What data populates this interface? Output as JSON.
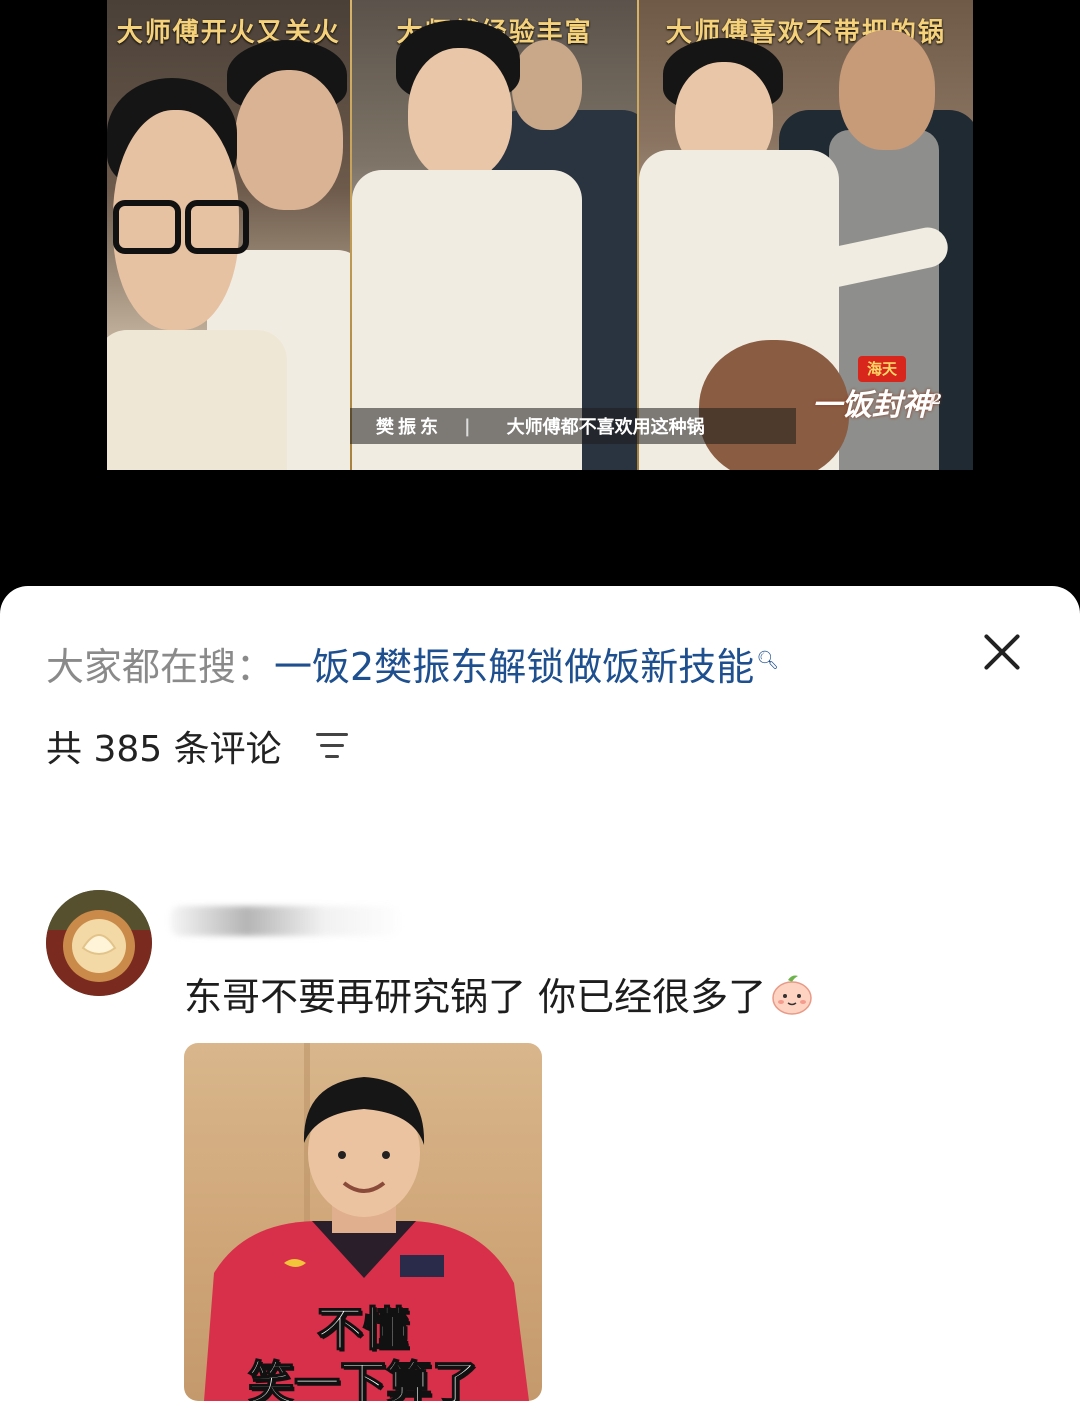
{
  "video": {
    "panels": [
      {
        "caption": "大师傅开火又关火"
      },
      {
        "caption": "大师傅经验丰富"
      },
      {
        "caption": "大师傅喜欢不带把的锅"
      }
    ],
    "subtitle": {
      "speaker": "樊振东",
      "separator": "|",
      "text": "大师傅都不喜欢用这种锅"
    },
    "logo": {
      "sponsor": "海天",
      "title": "一饭封神",
      "superscript": "2"
    }
  },
  "comments_sheet": {
    "search": {
      "prefix": "大家都在搜：",
      "query": "一饭2樊振东解锁做饭新技能",
      "icon": "search-icon"
    },
    "close_icon": "close-icon",
    "count_label": "共 385 条评论",
    "sort_icon": "sort-icon",
    "comments": [
      {
        "avatar_icon": "avatar",
        "username": "",
        "text": "东哥不要再研究锅了 你已经很多了",
        "emoji": "peach-face-emoji",
        "meme": {
          "line1": "不懂",
          "line2": "笑一下算了"
        }
      }
    ]
  },
  "colors": {
    "caption_gold": "#f5d27a",
    "link_blue": "#1e4f8f",
    "prefix_gray": "#8a8a8a",
    "sheet_bg": "#ffffff",
    "page_bg": "#000000"
  }
}
